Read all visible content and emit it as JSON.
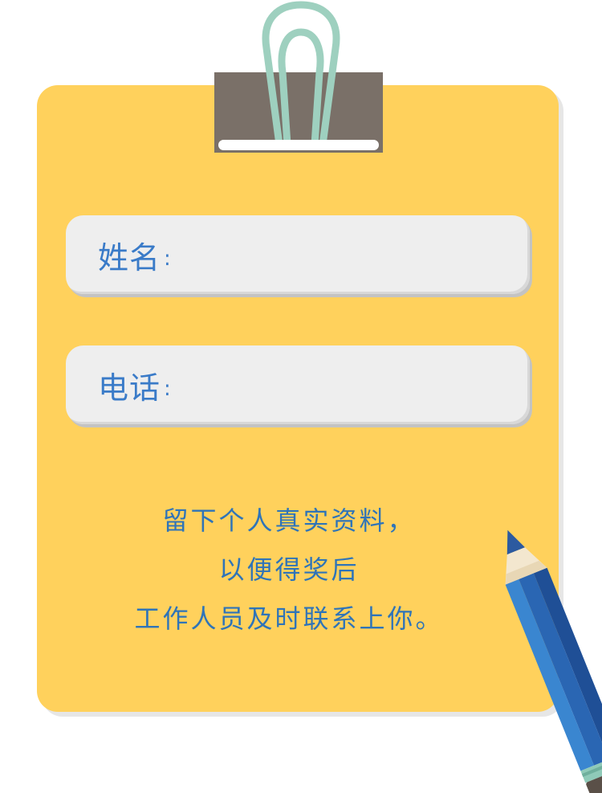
{
  "form": {
    "name_label": "姓名",
    "name_colon": ":",
    "phone_label": "电话",
    "phone_colon": ":"
  },
  "message": {
    "line1": "留下个人真实资料，",
    "line2": "以便得奖后",
    "line3": "工作人员及时联系上你。"
  },
  "colors": {
    "board": "#ffd15c",
    "field": "#eeeeee",
    "text_blue": "#3a7bc8",
    "clip": "#7a7068",
    "clip_wire": "#9ed0bf",
    "pencil": "#2f6bb8"
  },
  "icons": {
    "clip": "binder-clip-icon",
    "pencil": "pencil-icon"
  }
}
